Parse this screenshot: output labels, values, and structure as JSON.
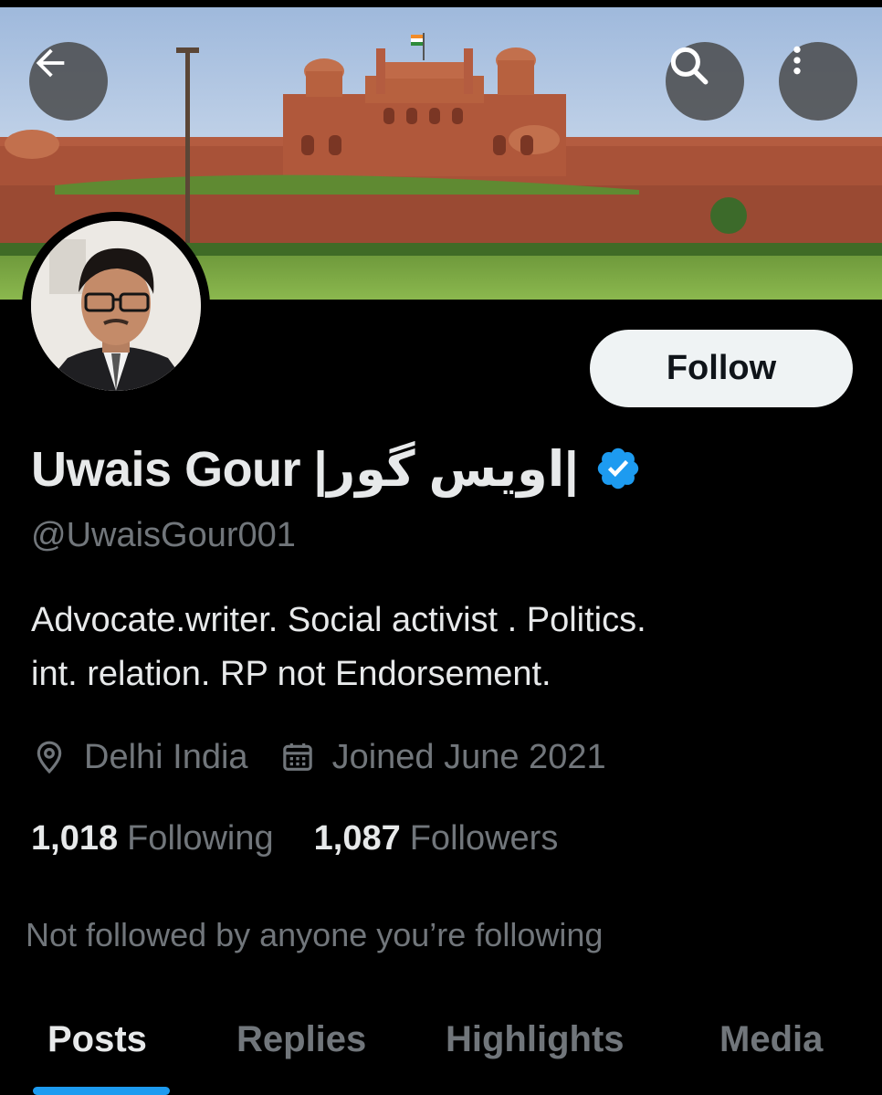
{
  "profile": {
    "display_name": "Uwais Gour |اویس گور|",
    "handle": "@UwaisGour001",
    "bio_line1": "Advocate.writer. Social activist . Politics.",
    "bio_line2": "int. relation. RP not Endorsement.",
    "location": "Delhi India",
    "joined": "Joined June 2021",
    "verified": true
  },
  "stats": {
    "following_count": "1,018",
    "following_label": "Following",
    "followers_count": "1,087",
    "followers_label": "Followers"
  },
  "follow_button": {
    "label": "Follow"
  },
  "mutuals_text": "Not followed by anyone you’re following",
  "tabs": [
    {
      "label": "Posts",
      "active": true
    },
    {
      "label": "Replies",
      "active": false
    },
    {
      "label": "Highlights",
      "active": false
    },
    {
      "label": "Media",
      "active": false
    }
  ],
  "icons": {
    "back": "arrow-left-icon",
    "search": "search-icon",
    "more": "more-vertical-icon",
    "location": "location-pin-icon",
    "calendar": "calendar-icon",
    "verified": "verified-badge-icon"
  },
  "colors": {
    "background": "#000000",
    "accent": "#1d9bf0",
    "primary_text": "#e7e9ea",
    "secondary_text": "#71767b"
  }
}
